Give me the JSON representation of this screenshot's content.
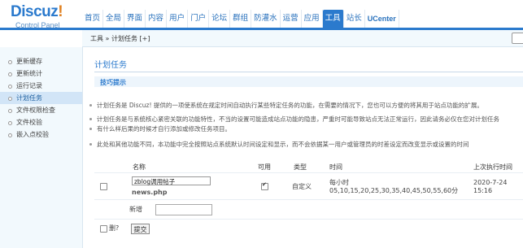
{
  "logo": {
    "brand": "Discuz",
    "mark": "!",
    "subtitle": "Control Panel"
  },
  "nav": {
    "items": [
      {
        "label": "首页",
        "active": false
      },
      {
        "label": "全局",
        "active": false
      },
      {
        "label": "界面",
        "active": false
      },
      {
        "label": "内容",
        "active": false
      },
      {
        "label": "用户",
        "active": false
      },
      {
        "label": "门户",
        "active": false
      },
      {
        "label": "论坛",
        "active": false
      },
      {
        "label": "群组",
        "active": false
      },
      {
        "label": "防灌水",
        "active": false
      },
      {
        "label": "运营",
        "active": false
      },
      {
        "label": "应用",
        "active": false
      },
      {
        "label": "工具",
        "active": true
      },
      {
        "label": "站长",
        "active": false
      },
      {
        "label": "UCenter",
        "active": false
      }
    ]
  },
  "breadcrumb": "工具 » 计划任务  [+]",
  "sidebar": {
    "items": [
      {
        "label": "更新缓存",
        "active": false
      },
      {
        "label": "更新统计",
        "active": false
      },
      {
        "label": "运行记录",
        "active": false
      },
      {
        "label": "计划任务",
        "active": true
      },
      {
        "label": "文件权限检查",
        "active": false
      },
      {
        "label": "文件校验",
        "active": false
      },
      {
        "label": "嵌入点校验",
        "active": false
      }
    ]
  },
  "main": {
    "title": "计划任务",
    "tips_title": "技巧提示",
    "tips": [
      "计划任务是 Discuz! 提供的一项使系统在规定时间自动执行某些特定任务的功能，在需要的情况下，您也可以方便的将其用于站点功能的扩展。",
      "计划任务是与系统核心紧密关联的功能特性，不当的设置可能造成站点功能的隐患，严重时可能导致站点无法正常运行，因此请务必仅在您对计划任务",
      "有什么样后果的时候才自行添加或修改任务项目。",
      "此处和其他功能不同，本功能中完全按照站点系统默认时间设定和显示，而不会依据某一用户或管理员的时差设定而改变显示或设置的时间"
    ],
    "table": {
      "headers": {
        "name": "名称",
        "enabled": "可用",
        "type": "类型",
        "time": "时间",
        "last_run": "上次执行时间"
      },
      "rows": [
        {
          "name": "zblog调用帖子",
          "script": "news.php",
          "enabled": true,
          "type": "自定义",
          "time_line1": "每小时",
          "time_line2": "05,10,15,20,25,30,35,40,45,50,55,60分",
          "last_run_date": "2020-7-24",
          "last_run_time": "15:16"
        }
      ],
      "add_label": "新增",
      "delete_label": "删?",
      "submit_label": "提交"
    }
  }
}
